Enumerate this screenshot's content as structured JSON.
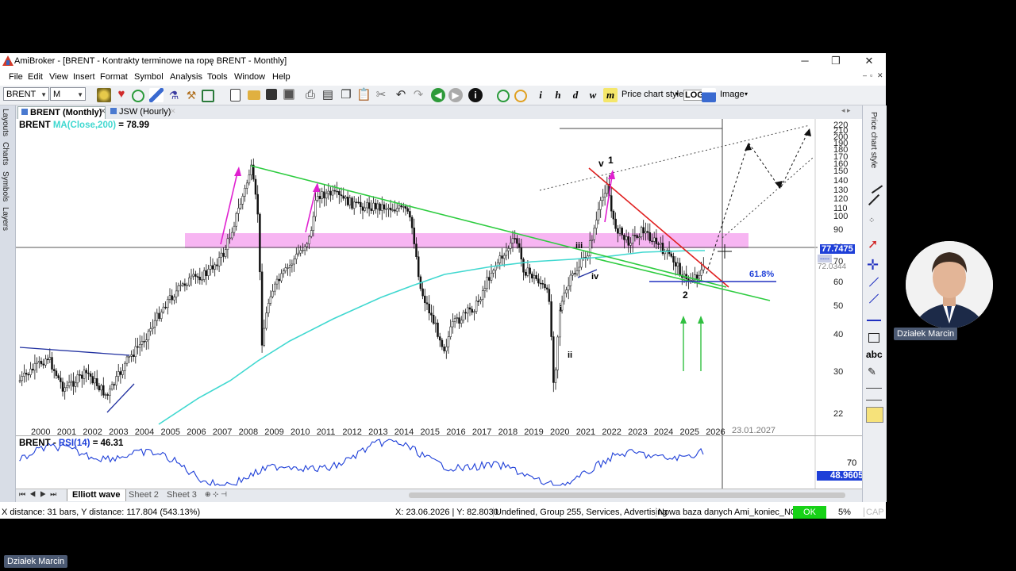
{
  "window": {
    "title": "AmiBroker - [BRENT - Kontrakty terminowe na ropę BRENT - Monthly]",
    "controls": {
      "minimize": "─",
      "maximize": "❐",
      "close": "✕"
    }
  },
  "menu": [
    "File",
    "Edit",
    "View",
    "Insert",
    "Format",
    "Symbol",
    "Analysis",
    "Tools",
    "Window",
    "Help"
  ],
  "mdi_controls": [
    "‒",
    "▫",
    "✕"
  ],
  "toolbar": {
    "symbol": "BRENT",
    "interval": "M",
    "price_chart_style": "Price chart style",
    "log": "LOG",
    "image": "Image"
  },
  "side_tabs": [
    "Layouts",
    "Charts",
    "Symbols",
    "Layers"
  ],
  "chart_tabs": [
    "BRENT (Monthly)",
    "JSW (Hourly)"
  ],
  "chart": {
    "header_symbol": "BRENT",
    "header_indicator": "MA(Close,200)",
    "header_value": "= 78.99",
    "x_labels": [
      "2000",
      "2001",
      "2002",
      "2003",
      "2004",
      "2005",
      "2006",
      "2007",
      "2008",
      "2009",
      "2010",
      "2011",
      "2012",
      "2013",
      "2014",
      "2015",
      "2016",
      "2017",
      "2018",
      "2019",
      "2020",
      "2021",
      "2022",
      "2023",
      "2024",
      "2025",
      "2026"
    ],
    "y_labels": [
      "220",
      "210",
      "200",
      "190",
      "180",
      "170",
      "160",
      "150",
      "140",
      "130",
      "120",
      "110",
      "100",
      "90",
      "80",
      "70",
      "60",
      "50",
      "40",
      "30",
      "22"
    ],
    "date_label": "23.01.2027",
    "current_price": "77.7475",
    "secondary_price": "72.0344",
    "fib_label": "61.8%",
    "wave_labels": {
      "v": "v",
      "one": "1",
      "iii": "iii",
      "iv": "iv",
      "i": "i",
      "ii": "ii",
      "two": "2"
    }
  },
  "rsi": {
    "symbol": "BRENT",
    "indicator": "RSI(14)",
    "value": "= 46.31",
    "level_70": "70",
    "current": "48.9605"
  },
  "right_panel": {
    "label": "Price chart style",
    "abc": "abc"
  },
  "sheets": [
    "Elliott wave",
    "Sheet 2",
    "Sheet 3"
  ],
  "status": {
    "left": "X distance: 31 bars, Y distance: 117.804 (543.13%)",
    "coords": "X: 23.06.2026 | Y: 82.8030",
    "info": "Undefined, Group 255, Services, Advertising",
    "db": "Nowa baza danych Ami_koniec_NOL",
    "ok": "OK",
    "zoom": "5%",
    "cap": "CAP"
  },
  "webcam": {
    "name": "Działek Marcin"
  },
  "footer_name": "Działek Marcin",
  "colors": {
    "resistance_zone": "#f6a8f0",
    "trend_green": "#2ecc40",
    "trend_red": "#e02020",
    "ma_line": "#40d8d0",
    "arrow_magenta": "#e020d0",
    "price_badge": "#1e3fd8",
    "ok_green": "#17d217"
  }
}
